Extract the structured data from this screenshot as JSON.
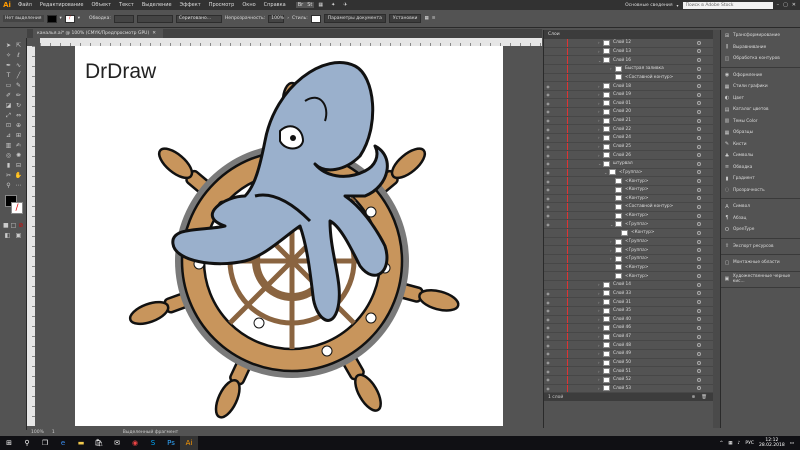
{
  "app": {
    "logo": "Ai"
  },
  "menu": [
    "Файл",
    "Редактирование",
    "Объект",
    "Текст",
    "Выделение",
    "Эффект",
    "Просмотр",
    "Окно",
    "Справка"
  ],
  "workspace": "Основные сведения",
  "search_placeholder": "Поиск в Adobe Stock",
  "control": {
    "selection_label": "Нет выделения",
    "stroke_label": "Обводка:",
    "brush_label": "Сериговано...",
    "opacity_label": "Непрозрачность:",
    "opacity_value": "100%",
    "style_label": "Стиль:",
    "doc_params": "Параметры документа",
    "preferences": "Установки"
  },
  "document_tab": "каналья.ai* @ 100% (CMYK/Предпросмотр GPU)",
  "artboard": {
    "brand": "DrDraw"
  },
  "status": {
    "zoom": "100%",
    "page": "1",
    "selection": "Выделенный фрагмент"
  },
  "layers_panel": {
    "title": "Слои",
    "rows": [
      {
        "label": "Слой 12",
        "indent": 0,
        "twist": "›",
        "eye": false
      },
      {
        "label": "Слой 13",
        "indent": 0,
        "twist": "›",
        "eye": false
      },
      {
        "label": "Слой 16",
        "indent": 0,
        "twist": "⌄",
        "eye": false
      },
      {
        "label": "Быстрая заливка",
        "indent": 2,
        "twist": "›",
        "eye": false
      },
      {
        "label": "<Составной контур>",
        "indent": 2,
        "twist": "",
        "eye": false
      },
      {
        "label": "Слой 18",
        "indent": 0,
        "twist": "›",
        "eye": true
      },
      {
        "label": "Слой 19",
        "indent": 0,
        "twist": "›",
        "eye": true
      },
      {
        "label": "Слой 01",
        "indent": 0,
        "twist": "›",
        "eye": true
      },
      {
        "label": "Слой 20",
        "indent": 0,
        "twist": "›",
        "eye": true
      },
      {
        "label": "Слой 21",
        "indent": 0,
        "twist": "›",
        "eye": true
      },
      {
        "label": "Слой 22",
        "indent": 0,
        "twist": "›",
        "eye": true
      },
      {
        "label": "Слой 24",
        "indent": 0,
        "twist": "›",
        "eye": true
      },
      {
        "label": "Слой 25",
        "indent": 0,
        "twist": "›",
        "eye": true
      },
      {
        "label": "Слой 26",
        "indent": 0,
        "twist": "›",
        "eye": true
      },
      {
        "label": "штурвал",
        "indent": 0,
        "twist": "⌄",
        "eye": true
      },
      {
        "label": "<Группа>",
        "indent": 1,
        "twist": "⌄",
        "eye": true
      },
      {
        "label": "<Контур>",
        "indent": 2,
        "twist": "",
        "eye": true
      },
      {
        "label": "<Контур>",
        "indent": 2,
        "twist": "",
        "eye": true
      },
      {
        "label": "<Контур>",
        "indent": 2,
        "twist": "",
        "eye": true
      },
      {
        "label": "<Составной контур>",
        "indent": 2,
        "twist": "",
        "eye": true
      },
      {
        "label": "<Контур>",
        "indent": 2,
        "twist": "",
        "eye": true
      },
      {
        "label": "<Группа>",
        "indent": 2,
        "twist": "⌄",
        "eye": true
      },
      {
        "label": "<Контур>",
        "indent": 3,
        "twist": "",
        "eye": false
      },
      {
        "label": "<Группа>",
        "indent": 2,
        "twist": "›",
        "eye": false
      },
      {
        "label": "<Группа>",
        "indent": 2,
        "twist": "›",
        "eye": false
      },
      {
        "label": "<Группа>",
        "indent": 2,
        "twist": "›",
        "eye": false
      },
      {
        "label": "<Контур>",
        "indent": 2,
        "twist": "",
        "eye": false
      },
      {
        "label": "<Контур>",
        "indent": 2,
        "twist": "",
        "eye": false
      },
      {
        "label": "Слой 14",
        "indent": 0,
        "twist": "›",
        "eye": false
      },
      {
        "label": "Слой 33",
        "indent": 0,
        "twist": "›",
        "eye": true
      },
      {
        "label": "Слой 31",
        "indent": 0,
        "twist": "›",
        "eye": true
      },
      {
        "label": "Слой 35",
        "indent": 0,
        "twist": "›",
        "eye": true
      },
      {
        "label": "Слой 40",
        "indent": 0,
        "twist": "›",
        "eye": true
      },
      {
        "label": "Слой 46",
        "indent": 0,
        "twist": "›",
        "eye": true
      },
      {
        "label": "Слой 47",
        "indent": 0,
        "twist": "›",
        "eye": true
      },
      {
        "label": "Слой 48",
        "indent": 0,
        "twist": "›",
        "eye": true
      },
      {
        "label": "Слой 49",
        "indent": 0,
        "twist": "›",
        "eye": true
      },
      {
        "label": "Слой 50",
        "indent": 0,
        "twist": "›",
        "eye": true
      },
      {
        "label": "Слой 51",
        "indent": 0,
        "twist": "›",
        "eye": true
      },
      {
        "label": "Слой 52",
        "indent": 0,
        "twist": "›",
        "eye": true
      },
      {
        "label": "Слой 53",
        "indent": 0,
        "twist": "›",
        "eye": true
      }
    ],
    "footer": "1 слой"
  },
  "right_panel": {
    "groups": [
      [
        {
          "icon": "transform-icon",
          "glyph": "⊞",
          "label": "Трансформирование"
        },
        {
          "icon": "align-icon",
          "glyph": "⫼",
          "label": "Выравнивание"
        },
        {
          "icon": "pathfinder-icon",
          "glyph": "◫",
          "label": "Обработка контуров"
        }
      ],
      [
        {
          "icon": "appearance-icon",
          "glyph": "◉",
          "label": "Оформление"
        },
        {
          "icon": "graphic-styles-icon",
          "glyph": "▦",
          "label": "Стили графики"
        },
        {
          "icon": "color-icon",
          "glyph": "◐",
          "label": "Цвет"
        },
        {
          "icon": "color-guide-icon",
          "glyph": "▤",
          "label": "Каталог цветов"
        },
        {
          "icon": "color-themes-icon",
          "glyph": "▥",
          "label": "Темы Color"
        },
        {
          "icon": "swatches-icon",
          "glyph": "▦",
          "label": "Образцы"
        },
        {
          "icon": "brushes-icon",
          "glyph": "✎",
          "label": "Кисти"
        },
        {
          "icon": "symbols-icon",
          "glyph": "♣",
          "label": "Символы"
        },
        {
          "icon": "stroke-icon",
          "glyph": "≡",
          "label": "Обводка"
        },
        {
          "icon": "gradient-icon",
          "glyph": "▮",
          "label": "Градиент"
        },
        {
          "icon": "transparency-icon",
          "glyph": "◌",
          "label": "Прозрачность"
        }
      ],
      [
        {
          "icon": "character-icon",
          "glyph": "A",
          "label": "Символ"
        },
        {
          "icon": "paragraph-icon",
          "glyph": "¶",
          "label": "Абзац"
        },
        {
          "icon": "opentype-icon",
          "glyph": "O",
          "label": "OpenType"
        }
      ],
      [
        {
          "icon": "export-assets-icon",
          "glyph": "⇪",
          "label": "Экспорт ресурсов"
        }
      ],
      [
        {
          "icon": "artboards-icon",
          "glyph": "▢",
          "label": "Монтажные области"
        }
      ],
      [
        {
          "icon": "art-brush-icon",
          "glyph": "▣",
          "label": "Художественные черные кис..."
        }
      ]
    ]
  },
  "taskbar": {
    "lang": "РУС",
    "time": "12:12",
    "date": "28.02.2018"
  },
  "colors": {
    "octopus": "#9ab0cc",
    "wheel": "#c8955c",
    "wheel_shadow": "#808080",
    "outline": "#111111"
  }
}
